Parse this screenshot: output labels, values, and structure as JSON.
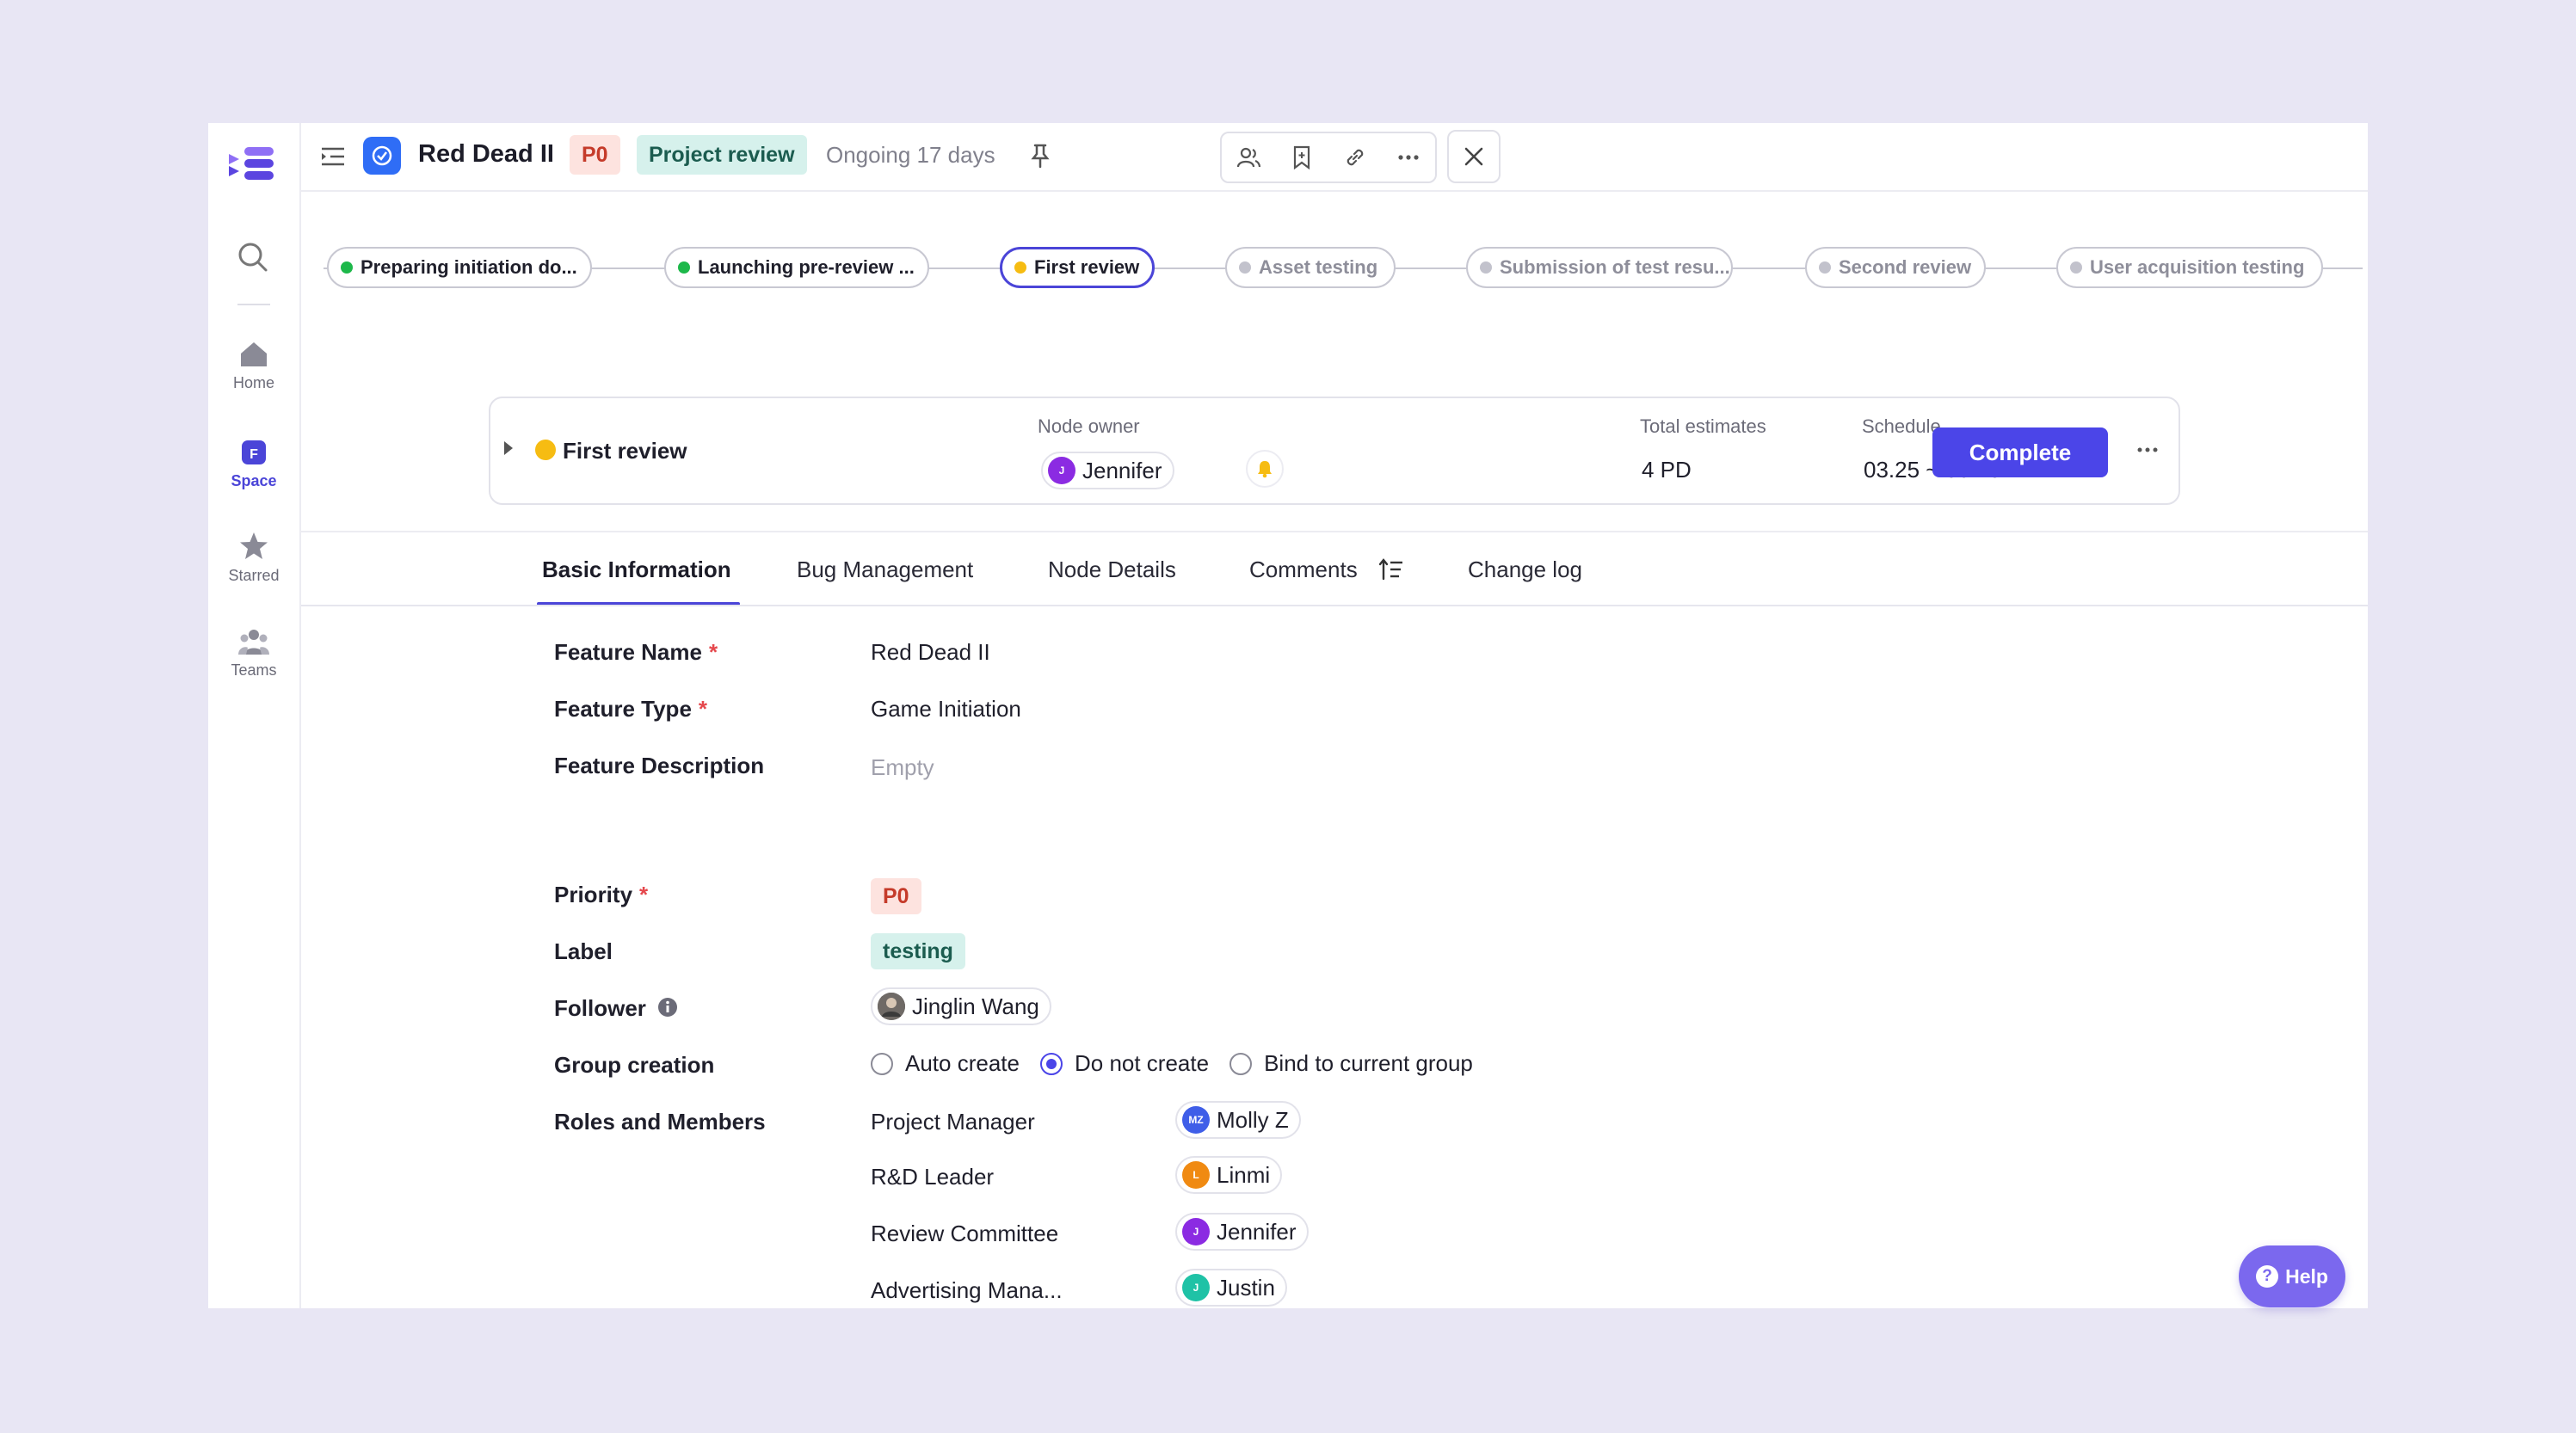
{
  "header": {
    "title": "Red Dead II",
    "priority_badge": "P0",
    "stage_badge": "Project review",
    "ongoing": "Ongoing 17 days"
  },
  "rail": {
    "items": [
      {
        "label": "Home"
      },
      {
        "label": "Space"
      },
      {
        "label": "Starred"
      },
      {
        "label": "Teams"
      }
    ]
  },
  "stepper": [
    {
      "label": "Preparing initiation do...",
      "status": "done"
    },
    {
      "label": "Launching pre-review ...",
      "status": "done"
    },
    {
      "label": "First review",
      "status": "current"
    },
    {
      "label": "Asset testing",
      "status": "pending"
    },
    {
      "label": "Submission of test resu...",
      "status": "pending"
    },
    {
      "label": "Second review",
      "status": "pending"
    },
    {
      "label": "User acquisition testing",
      "status": "pending"
    }
  ],
  "node": {
    "name": "First review",
    "owner_label": "Node owner",
    "owner": "Jennifer",
    "owner_initial": "J",
    "estimates_label": "Total estimates",
    "estimates": "4 PD",
    "schedule_label": "Schedule",
    "schedule": "03.25 ~ 03.28",
    "complete_label": "Complete"
  },
  "tabs": [
    {
      "label": "Basic Information",
      "active": true
    },
    {
      "label": "Bug Management"
    },
    {
      "label": "Node Details"
    },
    {
      "label": "Comments"
    },
    {
      "label": "Change log"
    }
  ],
  "form": {
    "feature_name_label": "Feature Name",
    "feature_name": "Red Dead II",
    "feature_type_label": "Feature Type",
    "feature_type": "Game Initiation",
    "feature_desc_label": "Feature Description",
    "feature_desc": "Empty",
    "priority_label": "Priority",
    "priority": "P0",
    "label_label": "Label",
    "label": "testing",
    "follower_label": "Follower",
    "follower": "Jinglin Wang",
    "group_creation_label": "Group creation",
    "group_options": [
      "Auto create",
      "Do not create",
      "Bind to current group"
    ],
    "group_selected": "Do not create",
    "roles_label": "Roles and Members",
    "required_mark": "*"
  },
  "roles": [
    {
      "role": "Project Manager",
      "member": "Molly Z",
      "initials": "MZ",
      "color": "#3f5ee8"
    },
    {
      "role": "R&D Leader",
      "member": "Linmi",
      "initials": "L",
      "color": "#f08a12"
    },
    {
      "role": "Review Committee",
      "member": "Jennifer",
      "initials": "J",
      "color": "#8b2be2"
    },
    {
      "role": "Advertising Mana...",
      "member": "Justin",
      "initials": "J",
      "color": "#1fc2a6"
    }
  ],
  "help_label": "Help",
  "colors": {
    "accent": "#4b45e8",
    "done": "#1db84a",
    "current": "#f6bc12",
    "pending": "#c2c2cc"
  }
}
